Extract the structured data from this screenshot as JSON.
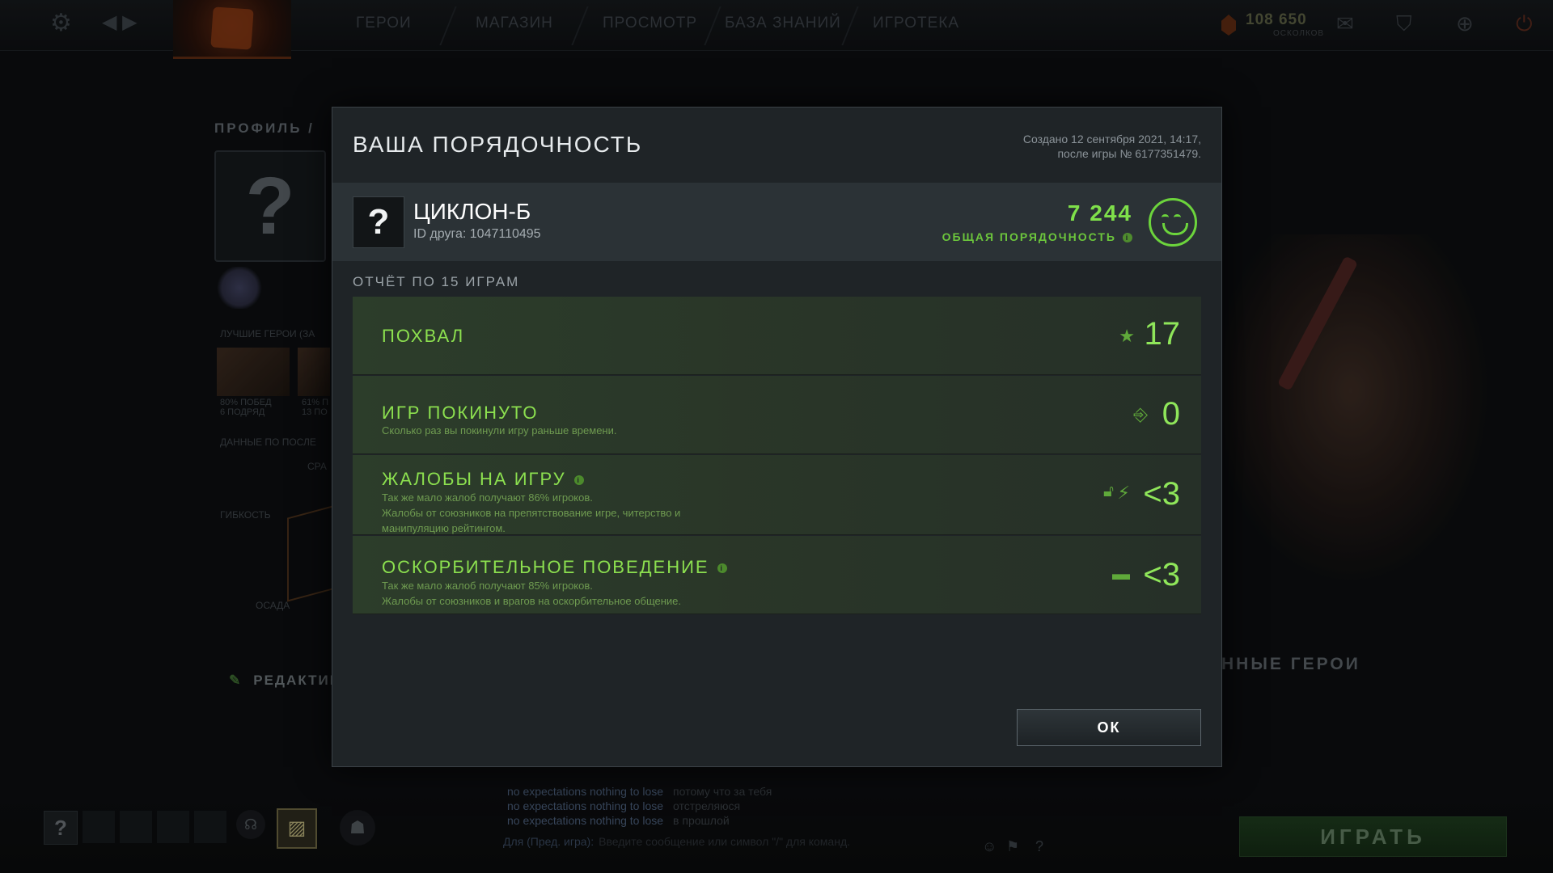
{
  "topbar": {
    "nav": [
      "ГЕРОИ",
      "МАГАЗИН",
      "ПРОСМОТР",
      "БАЗА ЗНАНИЙ",
      "ИГРОТЕКА"
    ],
    "shards_value": "108 650",
    "shards_label": "ОСКОЛКОВ",
    "icons": [
      "gear-icon",
      "back-forward-icon",
      "mail-icon",
      "armory-icon",
      "plus-icon",
      "power-icon"
    ]
  },
  "background": {
    "profile_label": "ПРОФИЛЬ /",
    "avatar_glyph": "?",
    "best_heroes": "ЛУЧШИЕ ГЕРОИ (ЗА",
    "hero1_stat": "80% ПОБЕД\n6 ПОДРЯД",
    "hero2_stat": "61% П\n13 ПО",
    "recent_data": "ДАННЫЕ ПО ПОСЛЕ",
    "radar_top": "СРА",
    "radar_left": "ГИБКОСТЬ",
    "radar_bottom": "ОСАДА",
    "edit": "РЕДАКТИР",
    "fav_heroes": "ННЫЕ ГЕРОИ",
    "chat": [
      {
        "name": "no expectations nothing to lose",
        "msg": "потому что за тебя"
      },
      {
        "name": "no expectations nothing to lose",
        "msg": "отстреляюся"
      },
      {
        "name": "no expectations nothing to lose",
        "msg": "в прошлой"
      }
    ],
    "chat_prefix": "Для (Пред. игра):",
    "chat_placeholder": "Введите сообщение или символ \"/\" для команд.",
    "play": "ИГРАТЬ",
    "help": "?"
  },
  "modal": {
    "title": "ВАША ПОРЯДОЧНОСТЬ",
    "created_line1": "Создано 12 сентября 2021, 14:17,",
    "created_line2": "после игры № 6177351479.",
    "user": {
      "avatar_glyph": "?",
      "name": "ЦИКЛОН-Б",
      "friend_id": "ID друга: 1047110495",
      "score": "7 244",
      "score_label": "ОБЩАЯ ПОРЯДОЧНОСТЬ"
    },
    "report_title": "ОТЧЁТ ПО 15 ИГРАМ",
    "stats": [
      {
        "title": "ПОХВАЛ",
        "desc": "",
        "value": "17",
        "icon": "star-icon"
      },
      {
        "title": "ИГР ПОКИНУТО",
        "desc": "Сколько раз вы покинули игру раньше времени.",
        "value": "0",
        "icon": "exit-icon"
      },
      {
        "title": "ЖАЛОБЫ НА ИГРУ",
        "desc": "Так же мало жалоб получают 86% игроков.\nЖалобы от союзников на препятствование игре, читерство и\nманипуляцию рейтингом.",
        "value": "<3",
        "icon": "lock-lightning-icon"
      },
      {
        "title": "ОСКОРБИТЕЛЬНОЕ ПОВЕДЕНИЕ",
        "desc": "Так же мало жалоб получают 85% игроков.\nЖалобы от союзников и врагов на оскорбительное общение.",
        "value": "<3",
        "icon": "chat-bubble-icon"
      }
    ],
    "ok": "ОК"
  }
}
